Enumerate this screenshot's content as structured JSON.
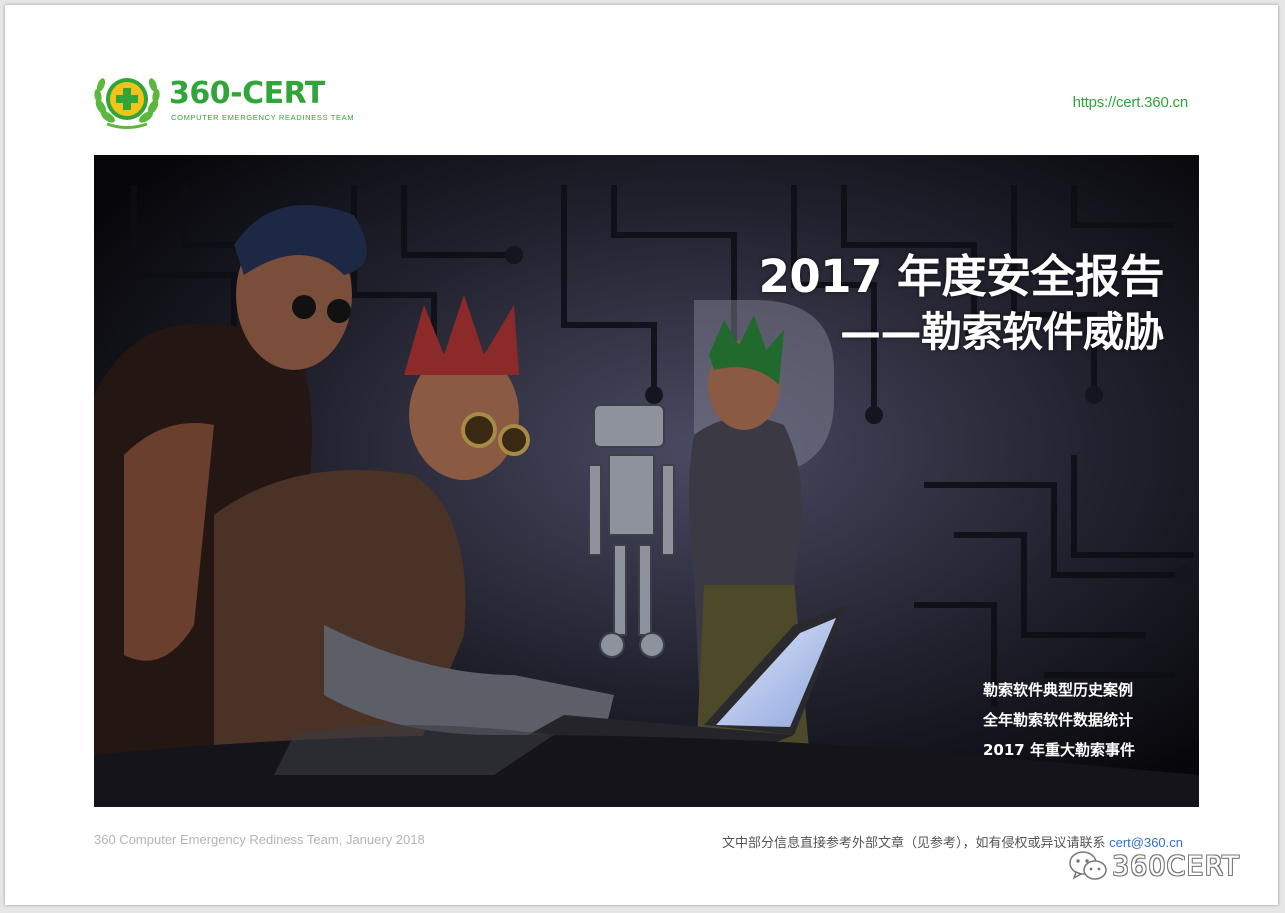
{
  "header": {
    "logo_text": "360-CERT",
    "logo_subtitle": "COMPUTER EMERGENCY READINESS TEAM",
    "url": "https://cert.360.cn"
  },
  "cover": {
    "title_line1": "2017 年度安全报告",
    "title_line2": "——勒索软件威胁",
    "toc": [
      "勒索软件典型历史案例",
      "全年勒索软件数据统计",
      "2017 年重大勒索事件"
    ]
  },
  "footer": {
    "left_text": "360 Computer Emergency Rediness Team, Januery 2018",
    "right_text": "文中部分信息直接参考外部文章（见参考），如有侵权或异议请联系",
    "email": "cert@360.cn",
    "watermark": "360CERT"
  },
  "colors": {
    "brand_green": "#2fa53a",
    "email_blue": "#2f6fd0",
    "cover_bg": "#0a0910"
  },
  "icons": {
    "logo_emblem": "laurel-plus-emblem",
    "watermark": "wechat-icon"
  }
}
